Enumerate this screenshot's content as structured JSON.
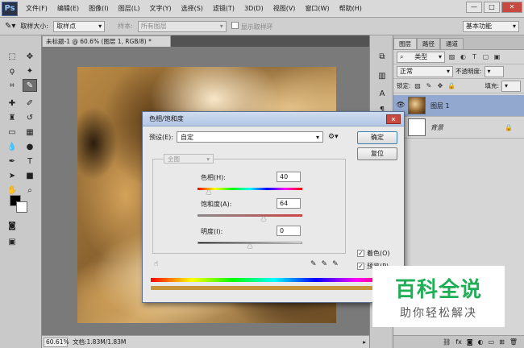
{
  "menubar": {
    "logo": "Ps",
    "items": [
      "文件(F)",
      "编辑(E)",
      "图像(I)",
      "图层(L)",
      "文字(Y)",
      "选择(S)",
      "滤镜(T)",
      "3D(D)",
      "视图(V)",
      "窗口(W)",
      "帮助(H)"
    ],
    "min": "—",
    "max": "□",
    "close": "✕"
  },
  "options": {
    "sample_size_label": "取样大小:",
    "sample_size_value": "取样点",
    "sample_label": "样本:",
    "sample_value": "所有图层",
    "show_ring": "显示取样环",
    "workspace": "基本功能"
  },
  "document": {
    "tab": "未标题-1 @ 60.6% (图层 1, RGB/8) *",
    "zoom": "60.61%",
    "docinfo": "文档:1.83M/1.83M"
  },
  "layers": {
    "tabs": [
      "图层",
      "路径",
      "通道"
    ],
    "kind_label": "类型",
    "blend_mode": "正常",
    "opacity_label": "不透明度:",
    "lock_label": "锁定:",
    "fill_label": "填充:",
    "items": [
      {
        "name": "图层 1"
      },
      {
        "name": "背景"
      }
    ]
  },
  "dialog": {
    "title": "色相/饱和度",
    "preset_label": "预设(E):",
    "preset_value": "自定",
    "ok": "确定",
    "reset": "复位",
    "channel": "全图",
    "hue_label": "色相(H):",
    "hue_value": "40",
    "sat_label": "饱和度(A):",
    "sat_value": "64",
    "light_label": "明度(I):",
    "light_value": "0",
    "colorize_label": "着色(O)",
    "preview_label": "预览(P)"
  },
  "watermark": {
    "title": "百科全说",
    "subtitle": "助你轻松解决"
  },
  "colors": {
    "accent": "#3c7fb1",
    "selected_layer": "#93a8cf",
    "watermark_green": "#1fae55"
  }
}
